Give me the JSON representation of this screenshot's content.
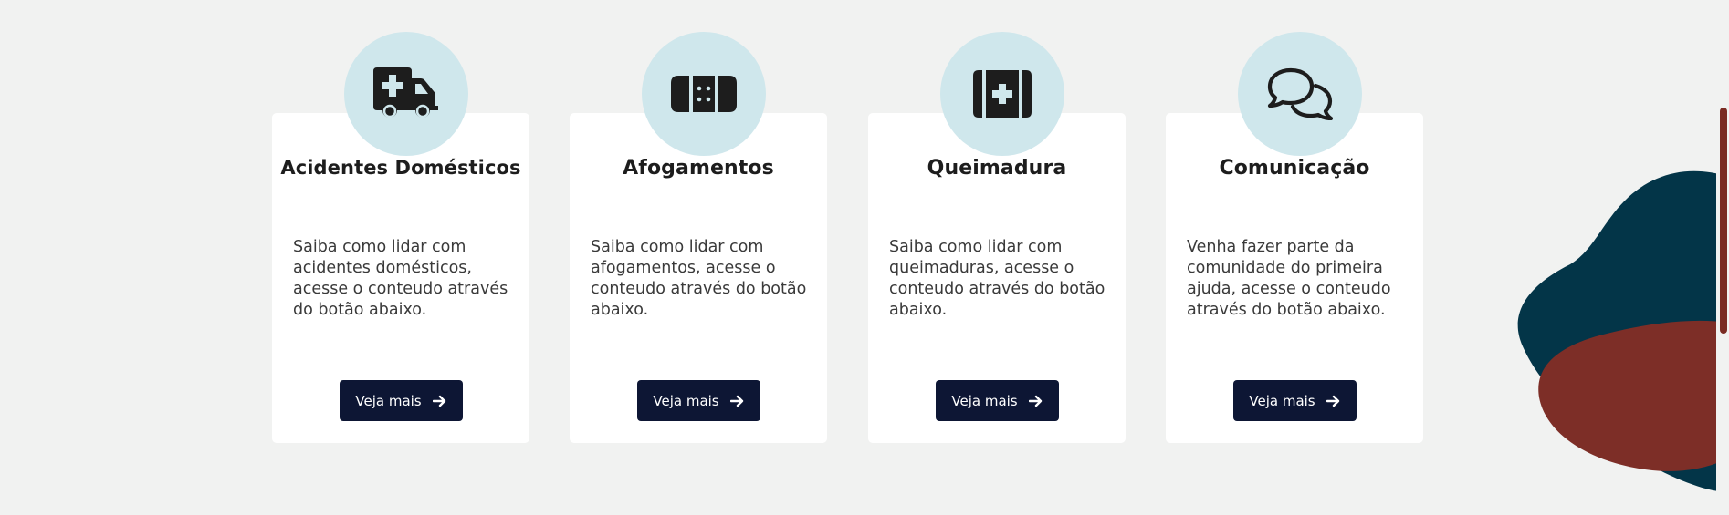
{
  "cards": [
    {
      "title": "Acidentes Domésticos",
      "description": "Saiba como lidar com acidentes domésticos, acesse o conteudo através do botão abaixo.",
      "button_label": "Veja mais",
      "icon": "ambulance-icon"
    },
    {
      "title": "Afogamentos",
      "description": "Saiba como lidar com afogamentos, acesse o conteudo através do botão abaixo.",
      "button_label": "Veja mais",
      "icon": "bandage-icon"
    },
    {
      "title": "Queimadura",
      "description": "Saiba como lidar com queimaduras, acesse o conteudo através do botão abaixo.",
      "button_label": "Veja mais",
      "icon": "first-aid-kit-icon"
    },
    {
      "title": "Comunicação",
      "description": "Venha fazer parte da comunidade do primeira ajuda, acesse o conteudo através do botão abaixo.",
      "button_label": "Veja mais",
      "icon": "comments-icon"
    }
  ],
  "colors": {
    "background": "#f1f2f1",
    "card": "#ffffff",
    "icon_circle": "#cfe7ec",
    "button": "#0d1634",
    "blob_dark": "#033548",
    "blob_red": "#7d2e27",
    "scrollbar": "#7a2b23"
  }
}
